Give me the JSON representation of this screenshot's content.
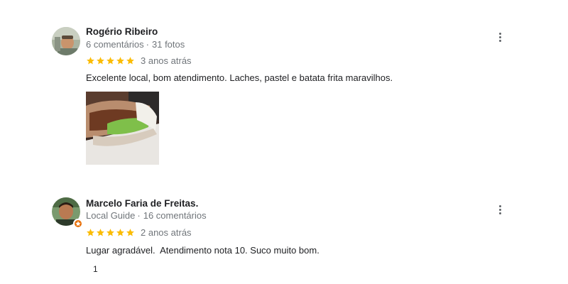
{
  "reviews": [
    {
      "name": "Rogério Ribeiro",
      "meta_primary": "6 comentários",
      "meta_secondary": "31 fotos",
      "rating": 5,
      "when": "3 anos atrás",
      "text": "Excelente local, bom atendimento. Laches, pastel e batata frita maravilhos.",
      "has_photo": true
    },
    {
      "name": "Marcelo Faria de Freitas.",
      "meta_primary": "Local Guide",
      "meta_secondary": "16 comentários",
      "rating": 5,
      "when": "2 anos atrás",
      "text": "Lugar agradável.  Atendimento nota 10. Suco muito bom.",
      "badge": "local-guide-icon"
    }
  ],
  "meta_separator": "·",
  "colors": {
    "star": "#fbbc04",
    "secondary_text": "#70757a",
    "local_guide_badge": "#e8710a"
  },
  "partial_text": "1"
}
